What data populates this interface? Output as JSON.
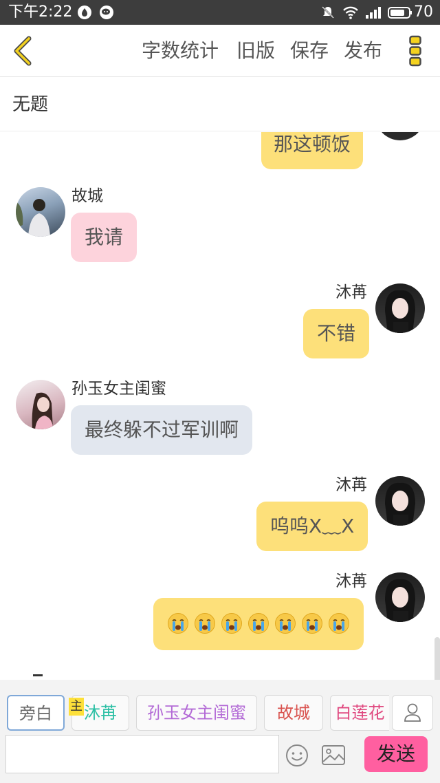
{
  "status_bar": {
    "time": "下午2:22",
    "battery": "70"
  },
  "toolbar": {
    "word_count": "字数统计",
    "old_version": "旧版",
    "save": "保存",
    "publish": "发布"
  },
  "document": {
    "title": "无题"
  },
  "messages": [
    {
      "side": "right",
      "text": "那这顿饭",
      "color": "#fde07a"
    },
    {
      "side": "left",
      "name": "故城",
      "text": "我请",
      "color": "#fdd3dc"
    },
    {
      "side": "right",
      "name": "沐苒",
      "text": "不错",
      "color": "#fde07a"
    },
    {
      "side": "left",
      "name": "孙玉女主闺蜜",
      "text": "最终躲不过军训啊",
      "color": "#e2e7ef"
    },
    {
      "side": "right",
      "name": "沐苒",
      "text": "呜呜X﹏X",
      "color": "#fde07a"
    },
    {
      "side": "right",
      "name": "沐苒",
      "emoji": "crying-face",
      "emoji_count": 7,
      "color": "#fde07a"
    }
  ],
  "roles": [
    {
      "label": "旁白",
      "color": "#666666"
    },
    {
      "label": "沐苒",
      "color": "#2bbfa4",
      "main_badge": "主"
    },
    {
      "label": "孙玉女主闺蜜",
      "color": "#b36ad6"
    },
    {
      "label": "故城",
      "color": "#d9534f"
    },
    {
      "label": "白莲花",
      "color": "#e0487f"
    }
  ],
  "composer": {
    "input_value": "",
    "send_label": "发送"
  }
}
